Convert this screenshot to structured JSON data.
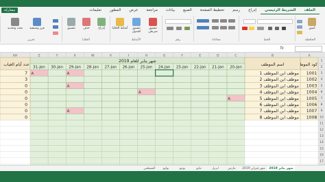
{
  "app": {
    "brand_color": "#217346",
    "share_label": "مشاركة"
  },
  "ribbon": {
    "tabs": [
      {
        "label": "الملف"
      },
      {
        "label": "الشريط الرئيسي",
        "active": true
      },
      {
        "label": "إدراج"
      },
      {
        "label": "رسم"
      },
      {
        "label": "تخطيط الصفحة"
      },
      {
        "label": "الصيغ"
      },
      {
        "label": "بيانات"
      },
      {
        "label": "مراجعة"
      },
      {
        "label": "عرض"
      },
      {
        "label": "المطور"
      },
      {
        "label": "تعليمات"
      }
    ],
    "groups": [
      {
        "label": "الحافظة"
      },
      {
        "label": "الخط"
      },
      {
        "label": "محاذاة"
      },
      {
        "label": "رقم"
      },
      {
        "label": "الأنماط"
      },
      {
        "label": "الخلايا"
      },
      {
        "label": "تحرير"
      }
    ],
    "buttons": {
      "paste": "لصق",
      "conditional": "تنسيق شرطي",
      "format_table": "تنسيق كجدول",
      "cell_styles": "أنماط الخلايا",
      "insert": "إدراج",
      "delete": "حذف",
      "format": "تنسيق",
      "sort": "فرز وتصفية",
      "find": "بحث وتحديد"
    }
  },
  "formula_bar": {
    "fx": "fx",
    "name_box": ""
  },
  "sheet": {
    "columns": [
      "A",
      "B",
      "C",
      "D",
      "E",
      "F",
      "G",
      "H",
      "I",
      "V",
      "W",
      "X",
      "Y",
      "Z",
      "AA",
      "AB",
      "AC",
      "AD",
      "AE",
      "AF",
      "AG",
      "AH"
    ],
    "header_title": "شهر يناير للعام 2019",
    "code_header": "كود الموظف",
    "name_header": "اسم الموظف",
    "absent_header": "عدد أيام الغياب",
    "dates": [
      "20-Jan",
      "21-Jan",
      "22-Jan",
      "23-Jan",
      "24-Jan",
      "25-Jan",
      "26-Jan",
      "27-Jan",
      "28-Jan",
      "29-Jan",
      "30-Jan",
      "31-Jan"
    ],
    "rows": [
      {
        "code": "1001",
        "name": "موظف ابن الموظف 1",
        "absent": "7",
        "marks": [
          9,
          11
        ]
      },
      {
        "code": "1002",
        "name": "موظف ابن الموظف 2",
        "absent": "3",
        "marks": []
      },
      {
        "code": "1003",
        "name": "موظف ابن الموظف 3",
        "absent": "0",
        "marks": [
          9
        ]
      },
      {
        "code": "1004",
        "name": "موظف ابن الموظف 4",
        "absent": "0",
        "marks": [
          5
        ]
      },
      {
        "code": "1005",
        "name": "موظف ابن الموظف 5",
        "absent": "0",
        "marks": [
          0
        ]
      },
      {
        "code": "1006",
        "name": "موظف ابن الموظف 6",
        "absent": "0",
        "marks": []
      },
      {
        "code": "1007",
        "name": "موظف ابن الموظف 7",
        "absent": "0",
        "marks": [
          9
        ]
      },
      {
        "code": "1008",
        "name": "موظف ابن الموظف 8",
        "absent": "0",
        "marks": []
      }
    ],
    "mark_letter": "A",
    "colors": {
      "grid_green": "#e2efda",
      "mark_pink": "#f4c2c9",
      "selected": "#217346"
    }
  },
  "sheet_tabs": [
    {
      "label": "شهر يناير 2019",
      "active": true
    },
    {
      "label": "شهر فبراير 2019"
    },
    {
      "label": "مارس"
    },
    {
      "label": "ابريل"
    },
    {
      "label": "مايو"
    },
    {
      "label": "يونيو"
    },
    {
      "label": "يوليو"
    },
    {
      "label": "أغسطس"
    }
  ]
}
